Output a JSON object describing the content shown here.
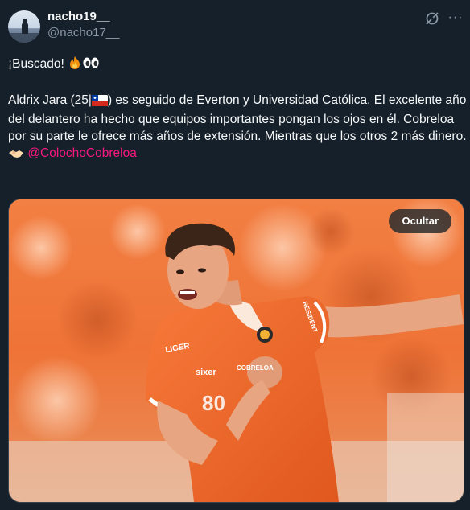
{
  "author": {
    "display_name": "nacho19__",
    "handle": "@nacho17__"
  },
  "tweet": {
    "line1": "¡Buscado! ",
    "line2_part1": "Aldrix Jara (25|",
    "line2_part2": ") es seguido de Everton y Universidad Católica. El excelente año del delantero ha hecho que equipos importantes pongan los ojos en él. Cobreloa por su parte le ofrece más años de extensión. Mientras que los otros 2 más dinero.",
    "mention": "@ColochoCobreloa",
    "emojis": [
      "fire-emoji",
      "eyes-emoji",
      "chile-flag-emoji",
      "handshake-emoji"
    ]
  },
  "media": {
    "hide_label": "Ocultar",
    "jersey_sponsor": "sixer",
    "jersey_brand": "LIGER",
    "jersey_club": "COBRELOA",
    "jersey_number": "80",
    "jersey_sleeve": "RESIDENT"
  },
  "colors": {
    "background": "#15202b",
    "text": "#f7f9f9",
    "secondary": "#8b98a5",
    "mention": "#f91880",
    "jersey": "#f26c2a"
  },
  "icons": [
    "grok-icon",
    "more-icon"
  ]
}
